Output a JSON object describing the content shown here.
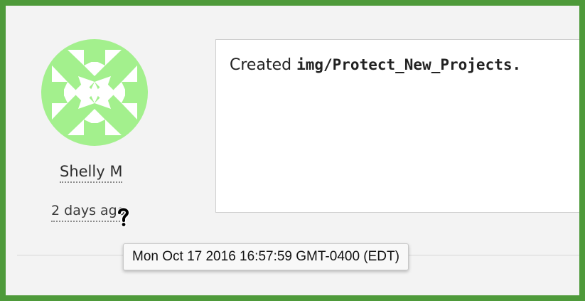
{
  "author": {
    "name": "Shelly M",
    "relative_time": "2 days ago",
    "avatar_color": "#a3f08d"
  },
  "message": {
    "prefix": "Created ",
    "code": "img/Protect_New_Projects."
  },
  "tooltip": {
    "text": "Mon Oct 17 2016 16:57:59 GMT-0400 (EDT)"
  },
  "colors": {
    "frame_border": "#4e9a3a",
    "background": "#f3f3f3"
  },
  "cursor": "help-cursor-icon"
}
